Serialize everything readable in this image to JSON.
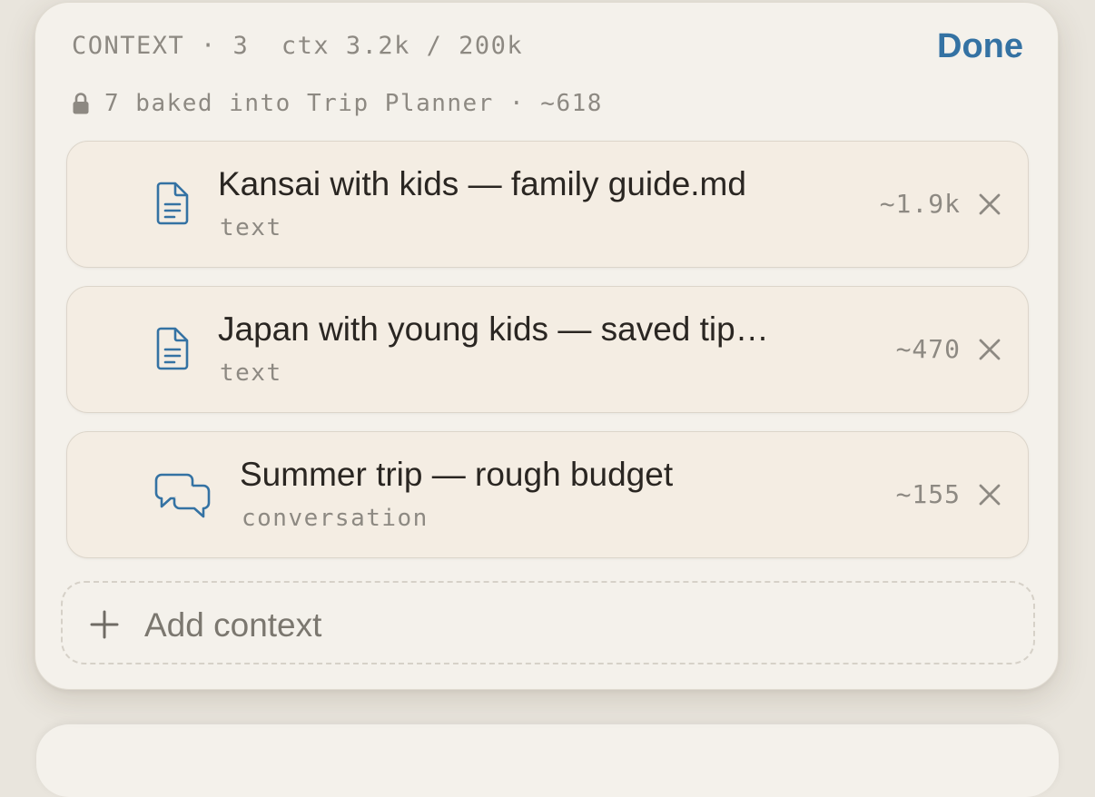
{
  "header": {
    "context_label": "CONTEXT · 3  ctx 3.2k / 200k",
    "done_label": "Done"
  },
  "baked": {
    "text": "7 baked into Trip Planner · ~618",
    "icon": "lock-icon"
  },
  "items": [
    {
      "title": "Kansai with kids — family guide.md",
      "kind": "text",
      "tokens": "~1.9k",
      "icon": "document-icon"
    },
    {
      "title": "Japan with young kids — saved tip…",
      "kind": "text",
      "tokens": "~470",
      "icon": "document-icon"
    },
    {
      "title": "Summer trip — rough budget",
      "kind": "conversation",
      "tokens": "~155",
      "icon": "chat-bubbles-icon"
    }
  ],
  "add_context": {
    "label": "Add context",
    "icon": "plus-icon"
  },
  "colors": {
    "accent": "#3472a3",
    "panel_bg": "#f4f1eb",
    "item_bg": "#f4ede3",
    "muted_text": "#8d8982"
  }
}
